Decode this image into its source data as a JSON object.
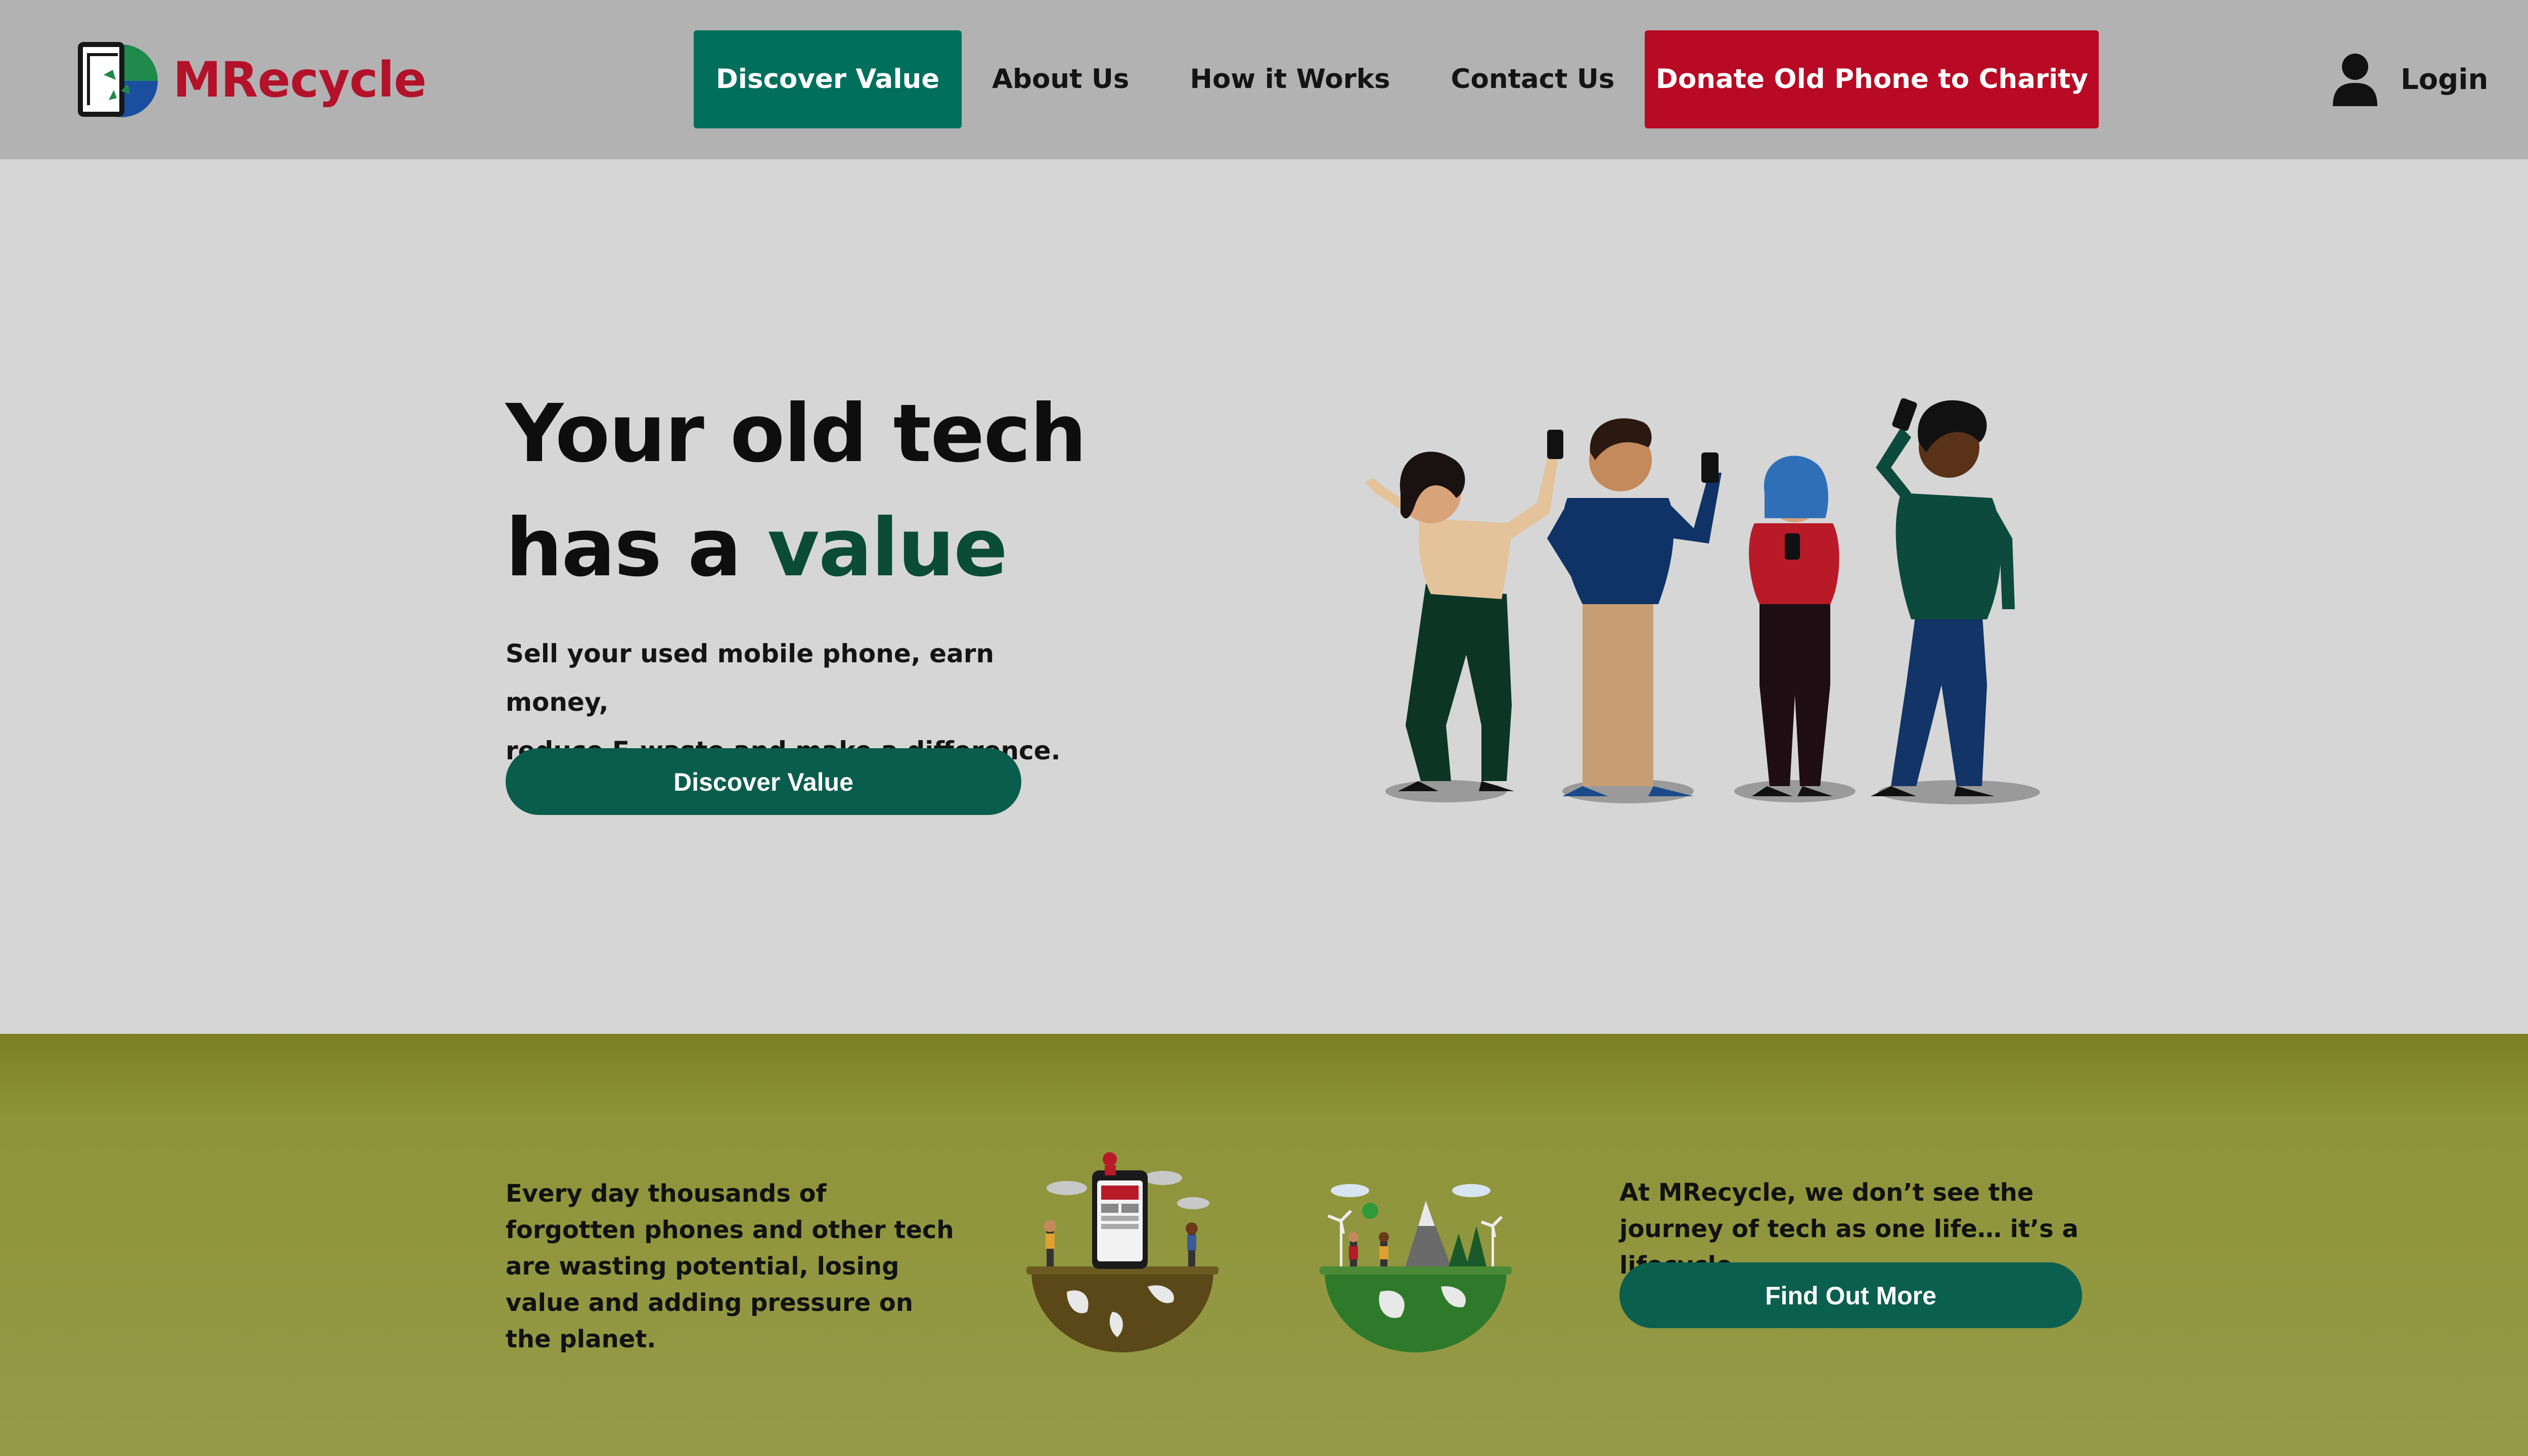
{
  "header": {
    "brand": "MRecycle",
    "nav": [
      {
        "label": "Discover Value"
      },
      {
        "label": "About Us"
      },
      {
        "label": "How it Works"
      },
      {
        "label": "Contact Us"
      },
      {
        "label": "Donate Old Phone to Charity"
      }
    ],
    "login_label": "Login"
  },
  "hero": {
    "title_line1": "Your old tech",
    "title_line2_prefix": "has a ",
    "title_line2_accent": "value",
    "subtitle_line1": "Sell your used mobile phone, earn money,",
    "subtitle_line2": "reduce E-waste and make a difference.",
    "cta_label": "Discover Value"
  },
  "lifecycle": {
    "left_text": "Every day thousands of forgotten phones and other tech are wasting potential, losing value and adding pressure on the planet.",
    "right_text": "At MRecycle, we don’t see the journey of tech as one life… it’s a lifecycle.",
    "cta_label": "Find Out More"
  },
  "colors": {
    "brand_red": "#b3122a",
    "primary_green": "#00705c",
    "donate_red": "#b80a24",
    "accent_green": "#0a4c35",
    "band_olive": "#8e9439"
  },
  "icons": {
    "logo": "recycle-phone-logo",
    "login": "user-icon"
  }
}
